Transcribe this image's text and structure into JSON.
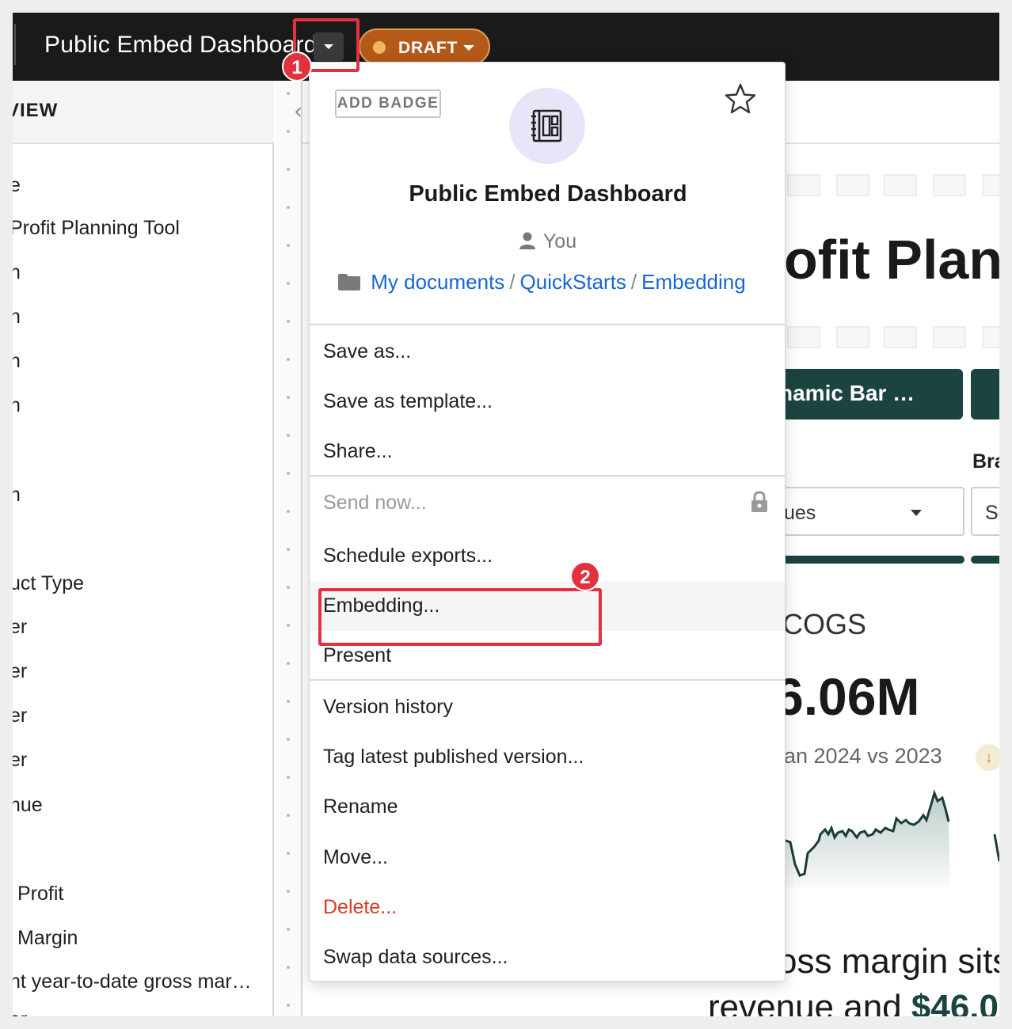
{
  "topbar": {
    "doc_title": "Public Embed Dashboard",
    "status_label": "DRAFT"
  },
  "left_panel": {
    "header": "VIEW",
    "items": [
      "e",
      "Profit Planning Tool",
      "n",
      "n",
      "n",
      "n",
      "n",
      "l",
      "uct Type",
      "er",
      "er",
      "er",
      "er",
      "nue",
      "Profit",
      "Margin",
      "nt year-to-date gross mar…",
      "er"
    ]
  },
  "canvas": {
    "big_title": "ofit Plann",
    "button_label": "namic Bar …",
    "filter_label": "Bra",
    "select1_value": "ues",
    "select2_value": "Se",
    "kpi_label": "COGS",
    "kpi_value": "6.06M",
    "kpi_compare": "an 2024 vs 2023",
    "para_line1": "oss margin sits",
    "para_line2_prefix": "revenue and ",
    "para_line2_value": "$46.0"
  },
  "menu": {
    "add_badge": "ADD BADGE",
    "title": "Public Embed Dashboard",
    "owner": "You",
    "path": [
      "My documents",
      "QuickStarts",
      "Embedding"
    ],
    "items": {
      "save_as": "Save as...",
      "save_as_template": "Save as template...",
      "share": "Share...",
      "send_now": "Send now...",
      "schedule_exports": "Schedule exports...",
      "embedding": "Embedding...",
      "present": "Present",
      "version_history": "Version history",
      "tag_latest": "Tag latest published version...",
      "rename": "Rename",
      "move": "Move...",
      "delete": "Delete...",
      "swap_data_sources": "Swap data sources..."
    }
  },
  "callouts": {
    "step1": "1",
    "step2": "2"
  },
  "colors": {
    "accent_dark_teal": "#1b4440",
    "callout_red": "#e2313f",
    "draft_orange": "#b5591a",
    "link_blue": "#1a64d6",
    "danger_red": "#d23e2b"
  }
}
